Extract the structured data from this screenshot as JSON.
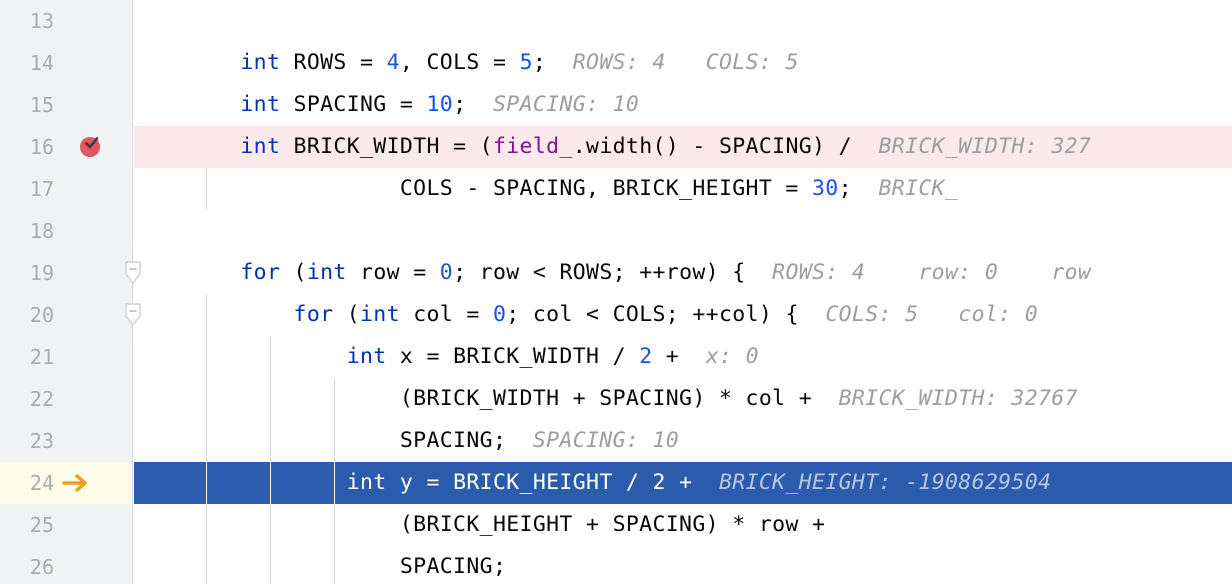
{
  "editor": {
    "language": "C++",
    "first_visible_line": 13,
    "colors": {
      "gutter_bg": "#f1f2f3",
      "gutter_border": "#d9dadd",
      "lineno_fg": "#a9adb2",
      "code_bg": "#ffffff",
      "error_line_bg": "#fbe9eb",
      "exec_line_bg": "#2b5bad",
      "exec_gutter_bg": "#fcfce9",
      "keyword": "#0033b3",
      "number": "#1750eb",
      "member": "#871094",
      "inlay_hint": "#9b9ea2",
      "inlay_hint_on_exec": "#b8c6e2",
      "breakpoint": "#e0565b",
      "exec_arrow": "#e9a217",
      "indent_guide": "#d9dadc"
    },
    "lines": [
      {
        "number": "13",
        "state": "normal",
        "gutter_icon": "none",
        "fold": false,
        "indent_guides": [],
        "tokens": []
      },
      {
        "number": "14",
        "state": "normal",
        "gutter_icon": "none",
        "fold": false,
        "indent_guides": [],
        "tokens": [
          {
            "t": "plain",
            "s": "        "
          },
          {
            "t": "keyword",
            "s": "int"
          },
          {
            "t": "plain",
            "s": " ROWS = "
          },
          {
            "t": "number",
            "s": "4"
          },
          {
            "t": "plain",
            "s": ", COLS = "
          },
          {
            "t": "number",
            "s": "5"
          },
          {
            "t": "plain",
            "s": ";  "
          },
          {
            "t": "hint",
            "s": "ROWS: 4   COLS: 5"
          }
        ]
      },
      {
        "number": "15",
        "state": "normal",
        "gutter_icon": "none",
        "fold": false,
        "indent_guides": [],
        "tokens": [
          {
            "t": "plain",
            "s": "        "
          },
          {
            "t": "keyword",
            "s": "int"
          },
          {
            "t": "plain",
            "s": " SPACING = "
          },
          {
            "t": "number",
            "s": "10"
          },
          {
            "t": "plain",
            "s": ";  "
          },
          {
            "t": "hint",
            "s": "SPACING: 10"
          }
        ]
      },
      {
        "number": "16",
        "state": "error",
        "gutter_icon": "breakpoint-verified",
        "fold": false,
        "indent_guides": [],
        "tokens": [
          {
            "t": "plain",
            "s": "        "
          },
          {
            "t": "keyword",
            "s": "int"
          },
          {
            "t": "plain",
            "s": " BRICK_WIDTH = ("
          },
          {
            "t": "member",
            "s": "field_"
          },
          {
            "t": "plain",
            "s": ".width() - SPACING) /  "
          },
          {
            "t": "hint",
            "s": "BRICK_WIDTH: 327"
          }
        ]
      },
      {
        "number": "17",
        "state": "normal",
        "gutter_icon": "none",
        "fold": false,
        "indent_guides": [
          72
        ],
        "tokens": [
          {
            "t": "plain",
            "s": "                    COLS - SPACING, BRICK_HEIGHT = "
          },
          {
            "t": "number",
            "s": "30"
          },
          {
            "t": "plain",
            "s": ";  "
          },
          {
            "t": "hint",
            "s": "BRICK_"
          }
        ]
      },
      {
        "number": "18",
        "state": "normal",
        "gutter_icon": "none",
        "fold": false,
        "indent_guides": [],
        "tokens": []
      },
      {
        "number": "19",
        "state": "normal",
        "gutter_icon": "none",
        "fold": true,
        "indent_guides": [],
        "tokens": [
          {
            "t": "plain",
            "s": "        "
          },
          {
            "t": "keyword",
            "s": "for"
          },
          {
            "t": "plain",
            "s": " ("
          },
          {
            "t": "keyword",
            "s": "int"
          },
          {
            "t": "plain",
            "s": " row = "
          },
          {
            "t": "number",
            "s": "0"
          },
          {
            "t": "plain",
            "s": "; row < ROWS; ++row) {  "
          },
          {
            "t": "hint",
            "s": "ROWS: 4    row: 0    row"
          }
        ]
      },
      {
        "number": "20",
        "state": "normal",
        "gutter_icon": "none",
        "fold": true,
        "indent_guides": [
          72
        ],
        "tokens": [
          {
            "t": "plain",
            "s": "            "
          },
          {
            "t": "keyword",
            "s": "for"
          },
          {
            "t": "plain",
            "s": " ("
          },
          {
            "t": "keyword",
            "s": "int"
          },
          {
            "t": "plain",
            "s": " col = "
          },
          {
            "t": "number",
            "s": "0"
          },
          {
            "t": "plain",
            "s": "; col < COLS; ++col) {  "
          },
          {
            "t": "hint",
            "s": "COLS: 5   col: 0"
          }
        ]
      },
      {
        "number": "21",
        "state": "normal",
        "gutter_icon": "none",
        "fold": false,
        "indent_guides": [
          72,
          136
        ],
        "tokens": [
          {
            "t": "plain",
            "s": "                "
          },
          {
            "t": "keyword",
            "s": "int"
          },
          {
            "t": "plain",
            "s": " x = BRICK_WIDTH / "
          },
          {
            "t": "number",
            "s": "2"
          },
          {
            "t": "plain",
            "s": " +  "
          },
          {
            "t": "hint",
            "s": "x: 0"
          }
        ]
      },
      {
        "number": "22",
        "state": "normal",
        "gutter_icon": "none",
        "fold": false,
        "indent_guides": [
          72,
          136,
          200
        ],
        "tokens": [
          {
            "t": "plain",
            "s": "                    (BRICK_WIDTH + SPACING) * col +  "
          },
          {
            "t": "hint",
            "s": "BRICK_WIDTH: 32767"
          }
        ]
      },
      {
        "number": "23",
        "state": "normal",
        "gutter_icon": "none",
        "fold": false,
        "indent_guides": [
          72,
          136,
          200
        ],
        "tokens": [
          {
            "t": "plain",
            "s": "                    SPACING;  "
          },
          {
            "t": "hint",
            "s": "SPACING: 10"
          }
        ]
      },
      {
        "number": "24",
        "state": "executing",
        "gutter_icon": "exec-arrow",
        "fold": false,
        "indent_guides": [
          72,
          136,
          200
        ],
        "tokens": [
          {
            "t": "plain",
            "s": "                "
          },
          {
            "t": "keyword",
            "s": "int"
          },
          {
            "t": "plain",
            "s": " y = BRICK_HEIGHT / "
          },
          {
            "t": "number",
            "s": "2"
          },
          {
            "t": "plain",
            "s": " +  "
          },
          {
            "t": "hint",
            "s": "BRICK_HEIGHT: -1908629504"
          }
        ]
      },
      {
        "number": "25",
        "state": "normal",
        "gutter_icon": "none",
        "fold": false,
        "indent_guides": [
          72,
          136,
          200
        ],
        "tokens": [
          {
            "t": "plain",
            "s": "                    (BRICK_HEIGHT + SPACING) * row +"
          }
        ]
      },
      {
        "number": "26",
        "state": "normal",
        "gutter_icon": "none",
        "fold": false,
        "indent_guides": [
          72,
          136,
          200
        ],
        "tokens": [
          {
            "t": "plain",
            "s": "                    SPACING;"
          }
        ]
      }
    ]
  }
}
